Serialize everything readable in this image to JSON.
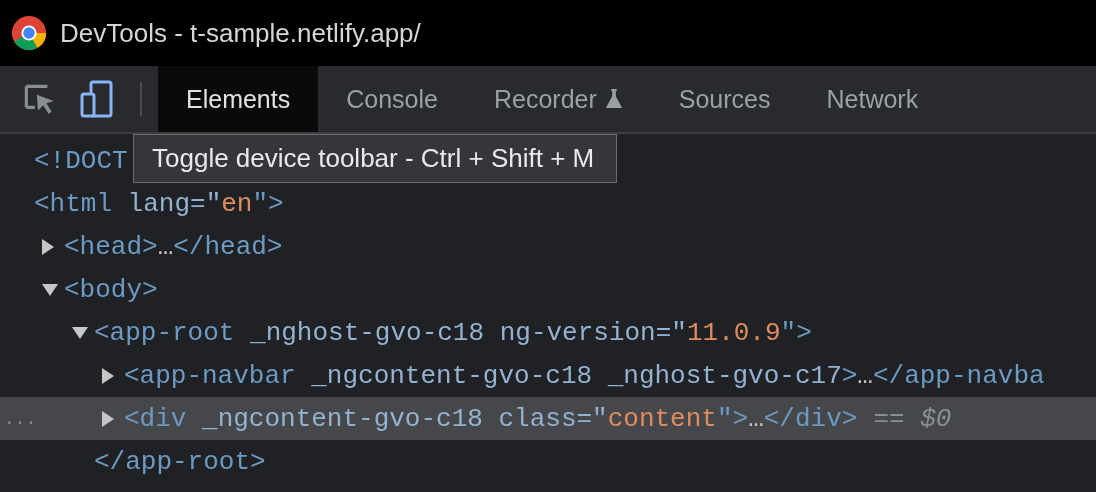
{
  "window": {
    "title": "DevTools - t-sample.netlify.app/"
  },
  "toolbar_buttons": [
    {
      "kind": "inspect",
      "on": false
    },
    {
      "kind": "device",
      "on": true
    }
  ],
  "tabs": [
    {
      "label": "Elements",
      "selected": true,
      "experimental": false
    },
    {
      "label": "Console",
      "selected": false,
      "experimental": false
    },
    {
      "label": "Recorder",
      "selected": false,
      "experimental": true
    },
    {
      "label": "Sources",
      "selected": false,
      "experimental": false
    },
    {
      "label": "Network",
      "selected": false,
      "experimental": false
    }
  ],
  "tooltip": {
    "text": "Toggle device toolbar - Ctrl + Shift + M"
  },
  "tree": [
    {
      "selected": false,
      "segments": [
        {
          "kind": "tag",
          "text": "<!DOCT"
        }
      ]
    },
    {
      "selected": false,
      "segments": [
        {
          "kind": "tag",
          "text": "<html"
        },
        {
          "kind": "attr",
          "text": " lang=\""
        },
        {
          "kind": "value",
          "text": "en"
        },
        {
          "kind": "tag",
          "text": "\">"
        }
      ],
      "children": [
        {
          "selected": false,
          "expanded": false,
          "segments": [
            {
              "kind": "tag",
              "text": "<head>"
            },
            {
              "kind": "text",
              "text": "…"
            },
            {
              "kind": "tag",
              "text": "</head>"
            }
          ]
        },
        {
          "selected": false,
          "expanded": true,
          "segments": [
            {
              "kind": "tag",
              "text": "<body>"
            }
          ],
          "children": [
            {
              "selected": false,
              "expanded": true,
              "segments": [
                {
                  "kind": "tag",
                  "text": "<app-root"
                },
                {
                  "kind": "attr",
                  "text": " _nghost-gvo-c18 ng-version=\""
                },
                {
                  "kind": "value",
                  "text": "11.0.9"
                },
                {
                  "kind": "tag",
                  "text": "\">"
                }
              ],
              "closing": "</app-root>",
              "children": [
                {
                  "selected": false,
                  "expanded": false,
                  "segments": [
                    {
                      "kind": "tag",
                      "text": "<app-navbar"
                    },
                    {
                      "kind": "attr",
                      "text": " _ngcontent-gvo-c18 _nghost-gvo-c17"
                    },
                    {
                      "kind": "tag",
                      "text": ">"
                    },
                    {
                      "kind": "text",
                      "text": "…"
                    },
                    {
                      "kind": "tag",
                      "text": "</app-navba"
                    }
                  ]
                },
                {
                  "selected": true,
                  "expanded": false,
                  "gutter": "...",
                  "marker": "== $0",
                  "segments": [
                    {
                      "kind": "tag",
                      "text": "<div"
                    },
                    {
                      "kind": "attr",
                      "text": " _ngcontent-gvo-c18 class=\""
                    },
                    {
                      "kind": "value",
                      "text": "content"
                    },
                    {
                      "kind": "tag",
                      "text": "\">"
                    },
                    {
                      "kind": "text",
                      "text": "…"
                    },
                    {
                      "kind": "tag",
                      "text": "</div>"
                    }
                  ]
                }
              ]
            }
          ]
        }
      ]
    }
  ]
}
